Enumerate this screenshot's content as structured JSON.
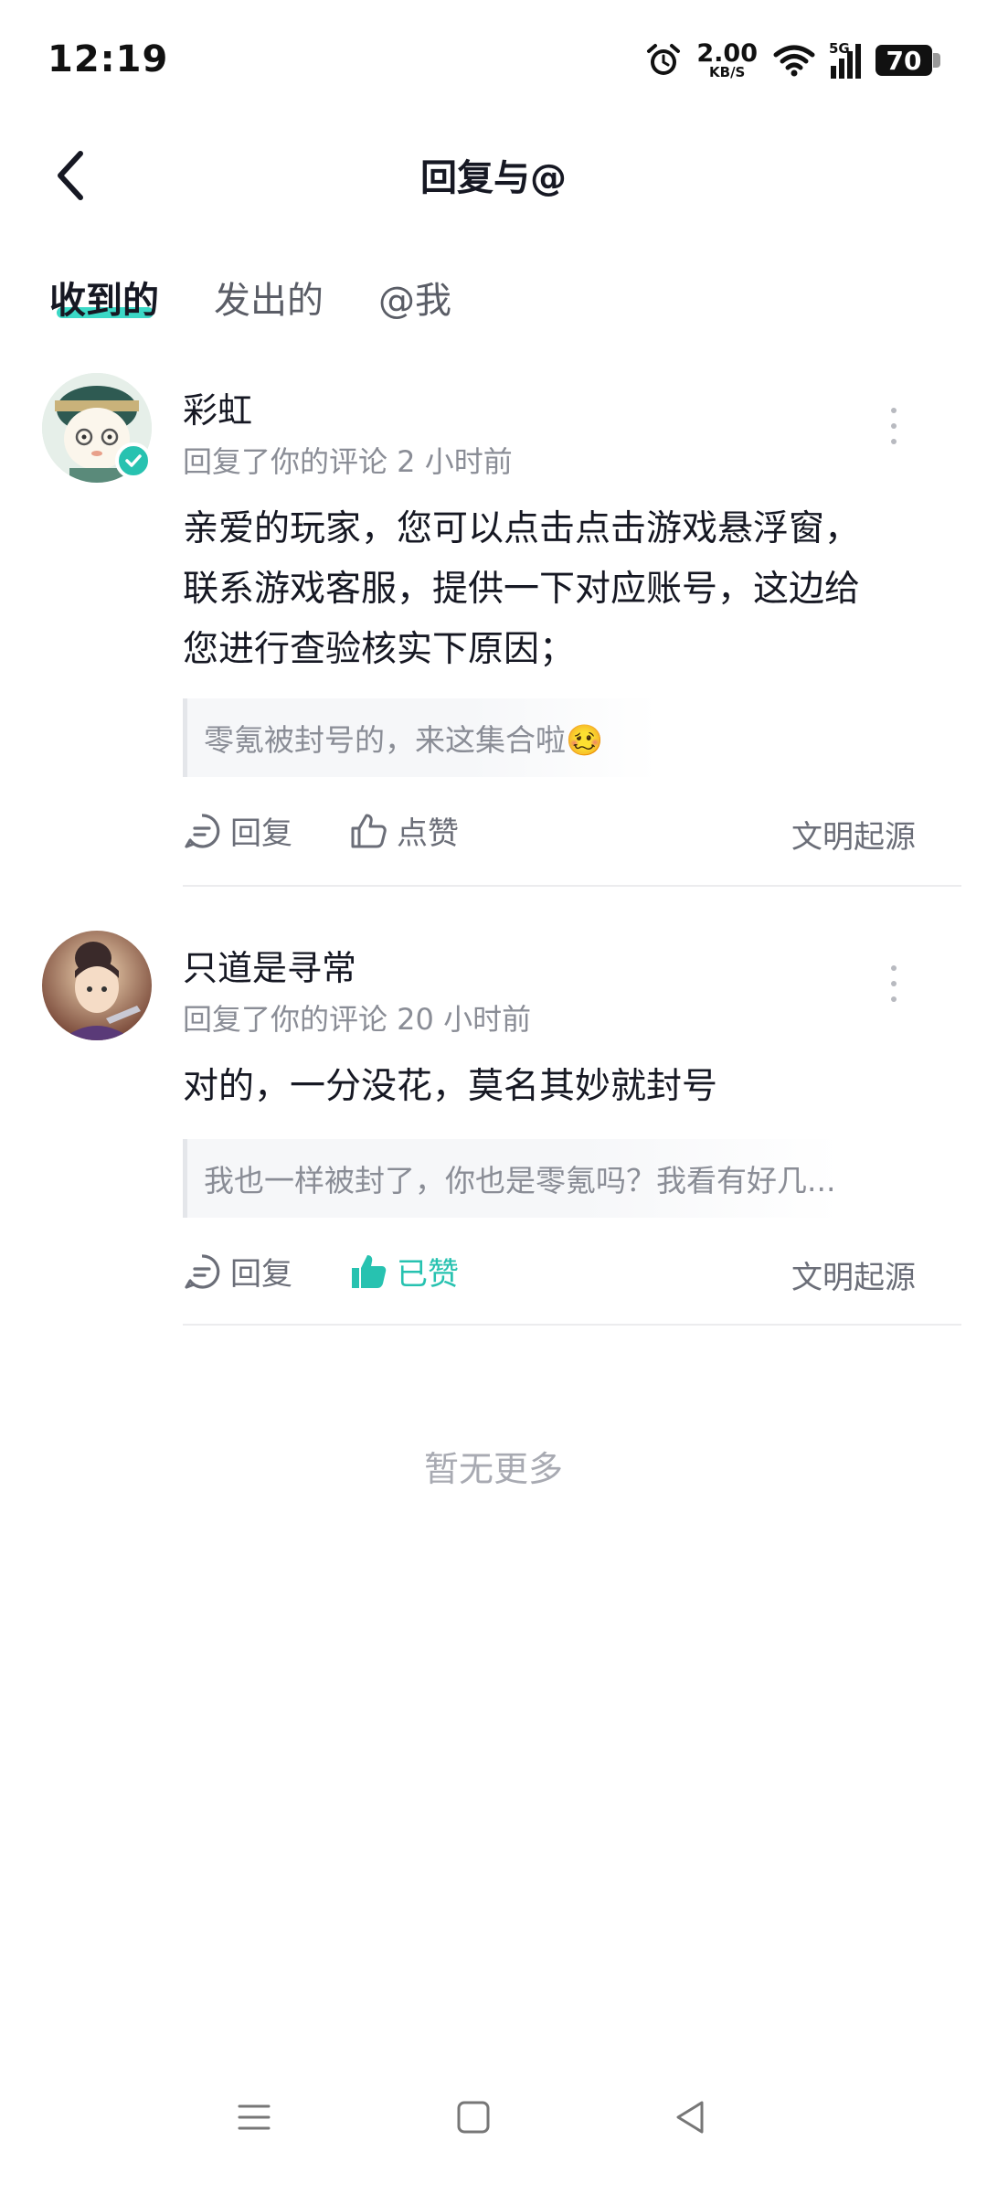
{
  "status_bar": {
    "time": "12:19",
    "net_speed_value": "2.00",
    "net_speed_unit": "KB/S",
    "network": "5G",
    "battery": "70"
  },
  "header": {
    "title": "回复与@",
    "back_icon": "chevron-left-icon"
  },
  "tabs": [
    {
      "label": "收到的",
      "active": true
    },
    {
      "label": "发出的",
      "active": false
    },
    {
      "label": "@我",
      "active": false
    }
  ],
  "comments": [
    {
      "author": "彩虹",
      "meta": "回复了你的评论 2 小时前",
      "verified": true,
      "body_lines": [
        "亲爱的玩家，您可以点击点击游戏悬浮窗，",
        "联系游戏客服，提供一下对应账号，这边给",
        "您进行查验核实下原因；"
      ],
      "quote": "零氪被封号的，来这集合啦🥴",
      "reply_label": "回复",
      "like_label": "点赞",
      "liked": false,
      "origin": "文明起源"
    },
    {
      "author": "只道是寻常",
      "meta": "回复了你的评论 20 小时前",
      "verified": false,
      "body_lines": [
        "对的，一分没花，莫名其妙就封号"
      ],
      "quote": "我也一样被封了，你也是零氪吗？我看有好几...",
      "reply_label": "回复",
      "like_label": "已赞",
      "liked": true,
      "origin": "文明起源"
    }
  ],
  "footer_text": "暂无更多",
  "colors": {
    "accent": "#27c2b0",
    "tab_underline": "#3bd8c6"
  }
}
